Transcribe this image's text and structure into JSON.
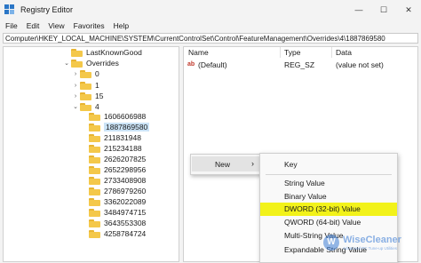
{
  "window": {
    "title": "Registry Editor",
    "controls": {
      "minimize": "—",
      "maximize": "☐",
      "close": "✕"
    }
  },
  "menu": {
    "items": [
      "File",
      "Edit",
      "View",
      "Favorites",
      "Help"
    ]
  },
  "address": "Computer\\HKEY_LOCAL_MACHINE\\SYSTEM\\CurrentControlSet\\Control\\FeatureManagement\\Overrides\\4\\1887869580",
  "tree": {
    "items": [
      {
        "label": "LastKnownGood",
        "chevron": ""
      },
      {
        "label": "Overrides",
        "chevron": "⌄"
      },
      {
        "label": "0",
        "chevron": "›"
      },
      {
        "label": "1",
        "chevron": "›"
      },
      {
        "label": "15",
        "chevron": "›"
      },
      {
        "label": "4",
        "chevron": "⌄"
      },
      {
        "label": "1606606988",
        "chevron": ""
      },
      {
        "label": "1887869580",
        "chevron": ""
      },
      {
        "label": "211831948",
        "chevron": ""
      },
      {
        "label": "215234188",
        "chevron": ""
      },
      {
        "label": "2626207825",
        "chevron": ""
      },
      {
        "label": "2652298956",
        "chevron": ""
      },
      {
        "label": "2733408908",
        "chevron": ""
      },
      {
        "label": "2786979260",
        "chevron": ""
      },
      {
        "label": "3362022089",
        "chevron": ""
      },
      {
        "label": "3484974715",
        "chevron": ""
      },
      {
        "label": "3643553308",
        "chevron": ""
      },
      {
        "label": "4258784724",
        "chevron": ""
      }
    ],
    "selected": "1887869580"
  },
  "values": {
    "headers": {
      "name": "Name",
      "type": "Type",
      "data": "Data"
    },
    "rows": [
      {
        "icon": "ab",
        "name": "(Default)",
        "type": "REG_SZ",
        "data": "(value not set)"
      }
    ]
  },
  "context_menu": {
    "new_label": "New",
    "arrow": "›"
  },
  "submenu": {
    "items": [
      "Key",
      "String Value",
      "Binary Value",
      "DWORD (32-bit) Value",
      "QWORD (64-bit) Value",
      "Multi-String Value",
      "Expandable String Value"
    ],
    "highlighted": "DWORD (32-bit) Value",
    "highlight_color": "#f2f21a"
  },
  "watermark": {
    "logo": "W",
    "name": "WiseCleaner",
    "tagline": "Advanced PC Tune-up Utilities"
  },
  "colors": {
    "accent": "#2a76c6",
    "selection": "#cce4f7",
    "folder": "#f4c84a"
  }
}
